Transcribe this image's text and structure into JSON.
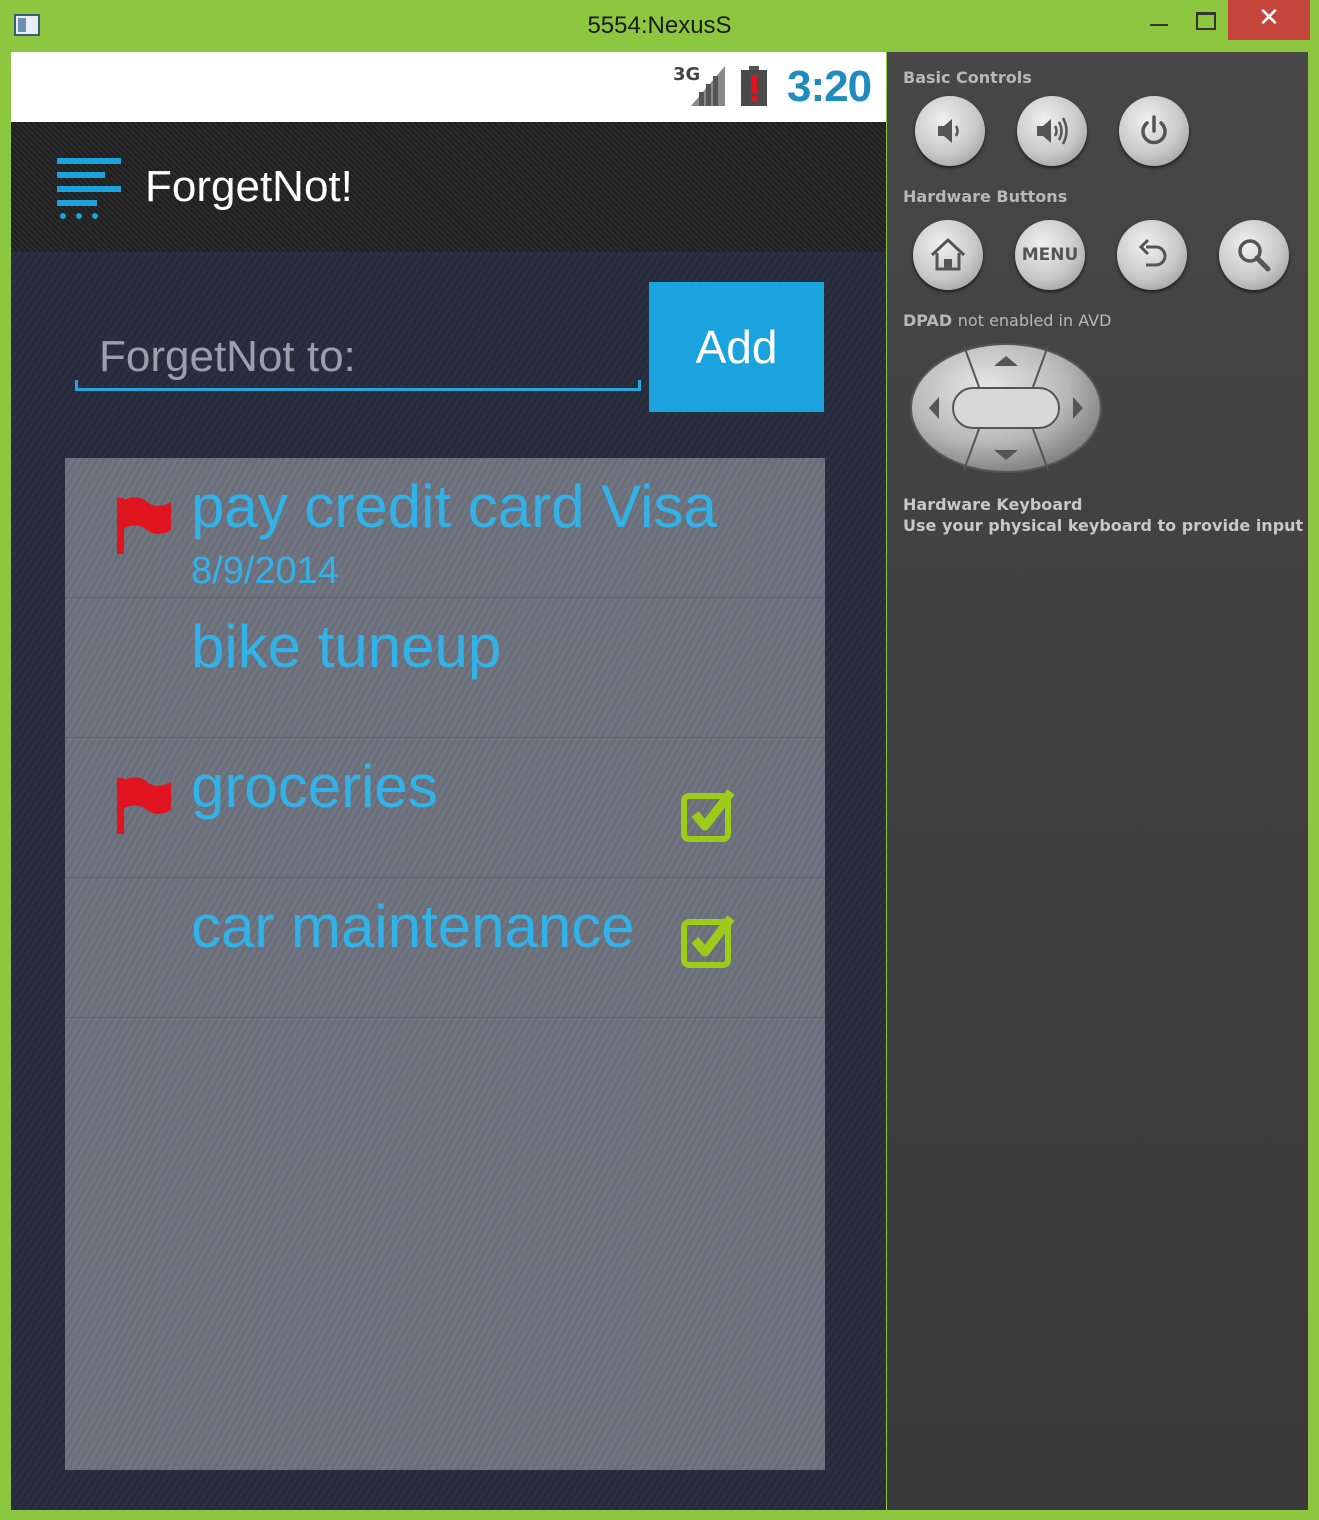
{
  "window": {
    "title": "5554:NexusS",
    "close_glyph": "✕"
  },
  "status_bar": {
    "network": "3G",
    "time": "3:20"
  },
  "app": {
    "title": "ForgetNot!"
  },
  "input": {
    "placeholder": "ForgetNot to:",
    "value": ""
  },
  "add_button": {
    "label": "Add"
  },
  "tasks": [
    {
      "label": "pay credit card Visa",
      "date": "8/9/2014",
      "flagged": true,
      "checked": false
    },
    {
      "label": "bike tuneup",
      "date": "",
      "flagged": false,
      "checked": false
    },
    {
      "label": "groceries",
      "date": "",
      "flagged": true,
      "checked": true
    },
    {
      "label": "car maintenance",
      "date": "",
      "flagged": false,
      "checked": true
    }
  ],
  "emulator": {
    "basic_controls": "Basic Controls",
    "hardware_buttons": "Hardware Buttons",
    "menu_label": "MENU",
    "dpad_title": "DPAD",
    "dpad_note": "not enabled in AVD",
    "keyboard_title": "Hardware Keyboard",
    "keyboard_note": "Use your physical keyboard to provide input"
  },
  "colors": {
    "accent": "#1aa3dc",
    "task_text": "#31b3ea",
    "flag": "#e0141e",
    "check": "#9ccc1a",
    "window_frame": "#8dc63f"
  }
}
